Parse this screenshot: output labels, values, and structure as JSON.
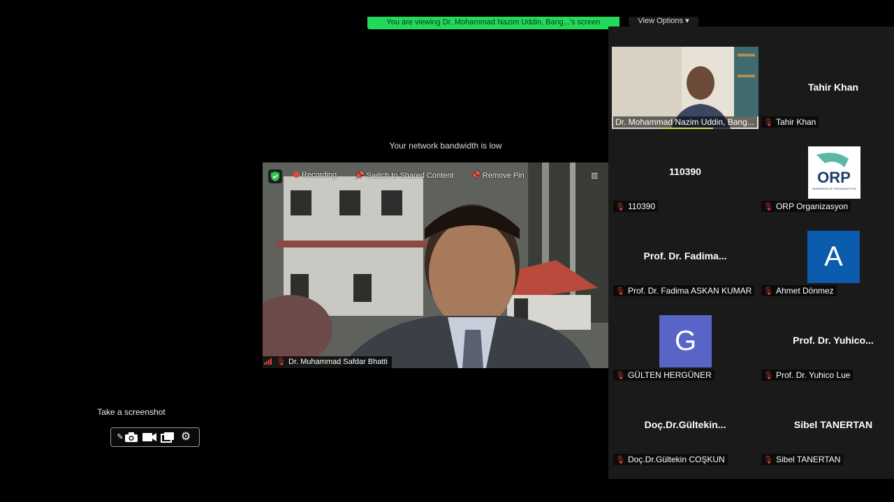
{
  "banner": {
    "text": "You are viewing Dr. Mohammad Nazim Uddin, Bang...'s screen"
  },
  "view_options": {
    "label": "View Options",
    "icon": "chevron-down-icon"
  },
  "status": {
    "bandwidth_message": "Your network bandwidth is low"
  },
  "main_video": {
    "toolbar": {
      "recording_label": "Recording",
      "switch_label": "Switch to Shared Content",
      "remove_pin_label": "Remove Pin"
    },
    "participant_name": "Dr. Muhammad Safdar Bhatti"
  },
  "gallery": {
    "tiles": [
      {
        "name": "Dr. Mohammad Nazim Uddin, Bang...",
        "display": "",
        "type": "video",
        "muted": false
      },
      {
        "name": "Tahir Khan",
        "display": "Tahir Khan",
        "type": "name",
        "muted": true
      },
      {
        "name": "110390",
        "display": "110390",
        "type": "name",
        "muted": true
      },
      {
        "name": "ORP Organizasyon",
        "display": "",
        "type": "logo",
        "logo_text": "ORP",
        "logo_subtext": "ZAMANINDA VE ORGANIZASYON",
        "muted": true
      },
      {
        "name": "Prof. Dr. Fadima ASKAN KUMAR",
        "display": "Prof. Dr. Fadima...",
        "type": "name",
        "muted": true
      },
      {
        "name": "Ahmet Dönmez",
        "display": "A",
        "type": "avatar",
        "avatar_color": "#0b5cad",
        "muted": true
      },
      {
        "name": "GÜLTEN HERGÜNER",
        "display": "G",
        "type": "avatar",
        "avatar_color": "#5865c7",
        "muted": true
      },
      {
        "name": "Prof. Dr. Yuhico Lue",
        "display": "Prof. Dr. Yuhico...",
        "type": "name",
        "muted": true
      },
      {
        "name": "Doç.Dr.Gültekin COŞKUN",
        "display": "Doç.Dr.Gültekin...",
        "type": "name",
        "muted": true
      },
      {
        "name": "Sibel TANERTAN",
        "display": "Sibel TANERTAN",
        "type": "name",
        "muted": true
      }
    ]
  },
  "screenshot_tool": {
    "tooltip": "Take a screenshot",
    "buttons": [
      "pen-icon",
      "camera-icon",
      "video-camera-icon",
      "windows-icon",
      "gear-icon"
    ]
  },
  "colors": {
    "banner": "#23d959",
    "mic_muted": "#e6433a",
    "speaker_highlight": "#d9d94a"
  }
}
